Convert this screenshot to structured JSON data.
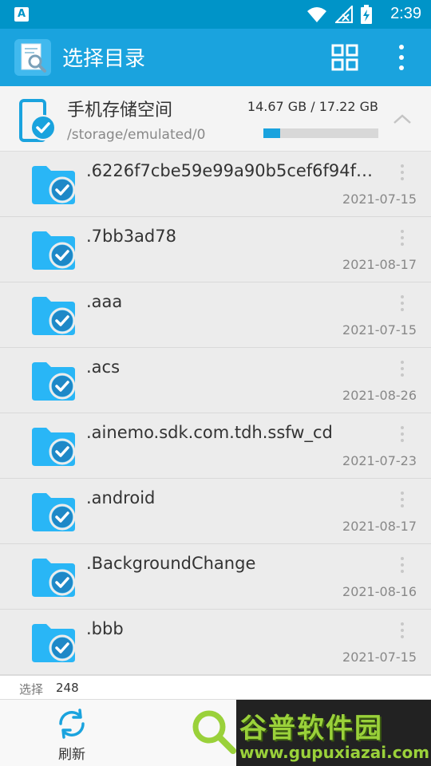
{
  "status_bar": {
    "left_badge": "A",
    "time": "2:39"
  },
  "app_bar": {
    "title": "选择目录",
    "grid_icon": "grid-view-icon",
    "more_icon": "more-vert-icon"
  },
  "storage": {
    "title": "手机存储空间",
    "path": "/storage/emulated/0",
    "size": "14.67 GB / 17.22 GB",
    "used_fraction": 0.148
  },
  "files": [
    {
      "name": ".6226f7cbe59e99a90b5cef6f94f9...",
      "date": "2021-07-15"
    },
    {
      "name": ".7bb3ad78",
      "date": "2021-08-17"
    },
    {
      "name": ".aaa",
      "date": "2021-07-15"
    },
    {
      "name": ".acs",
      "date": "2021-08-26"
    },
    {
      "name": ".ainemo.sdk.com.tdh.ssfw_cd",
      "date": "2021-07-23"
    },
    {
      "name": ".android",
      "date": "2021-08-17"
    },
    {
      "name": ".BackgroundChange",
      "date": "2021-08-16"
    },
    {
      "name": ".bbb",
      "date": "2021-07-15"
    }
  ],
  "selection": {
    "label": "选择",
    "count": "248"
  },
  "bottom_bar": {
    "refresh_label": "刷新"
  },
  "watermark": {
    "title": "谷普软件园",
    "url": "www.gupuxiazai.com"
  },
  "colors": {
    "status_bar": "#0094c8",
    "app_bar": "#1aa3de",
    "folder": "#29b6f6",
    "accent_green": "#9ad13a"
  }
}
